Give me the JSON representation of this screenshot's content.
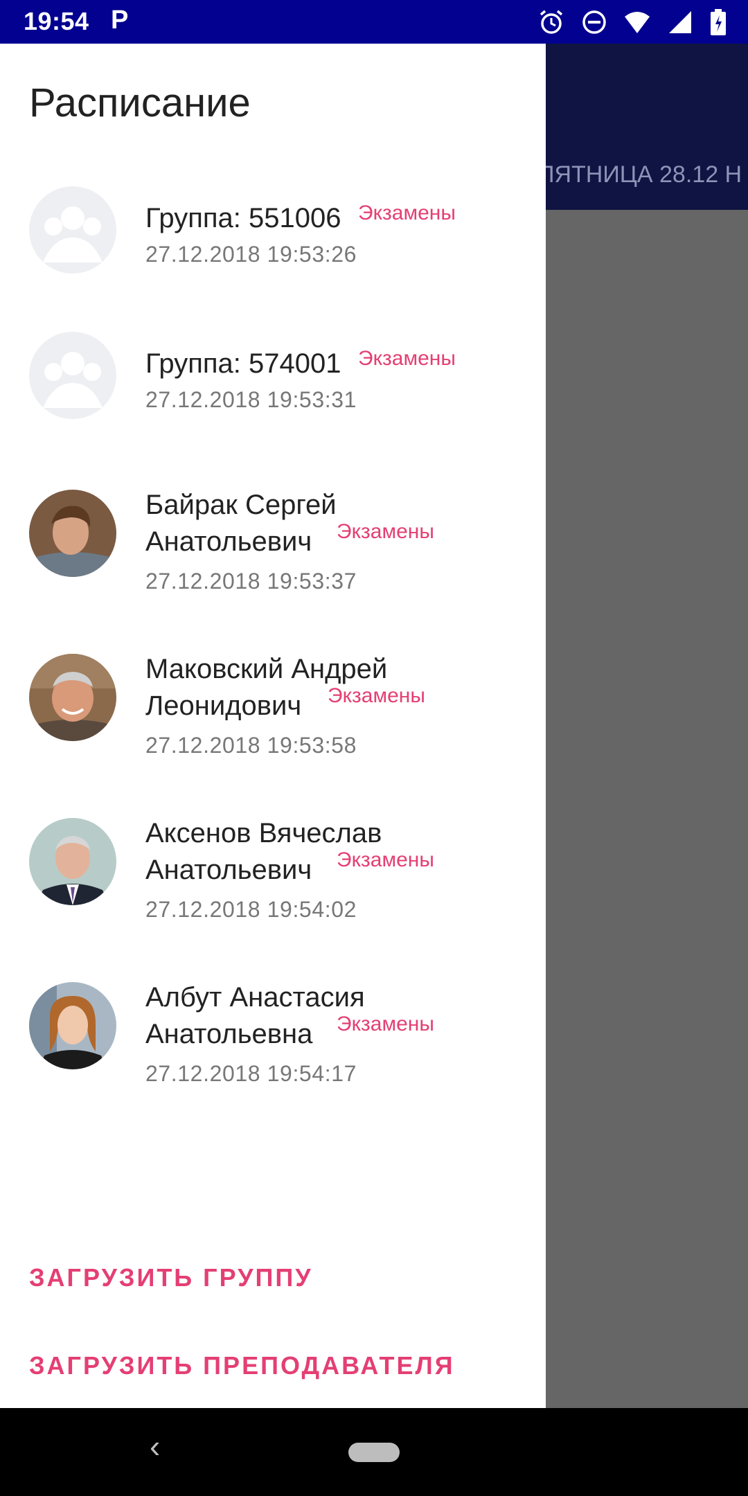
{
  "status_bar": {
    "time": "19:54",
    "app_indicator": "P",
    "icons": [
      "alarm-icon",
      "dnd-icon",
      "wifi-icon",
      "signal-icon",
      "battery-icon"
    ]
  },
  "background": {
    "day_label": "ПЯТНИЦА 28.12 Н"
  },
  "drawer": {
    "title": "Расписание",
    "entries": [
      {
        "name_line1": "Группа: 551006",
        "name_line2": "",
        "tag": "Экзамены",
        "date": "27.12.2018 19:53:26",
        "avatar": "group-placeholder-icon"
      },
      {
        "name_line1": "Группа: 574001",
        "name_line2": "",
        "tag": "Экзамены",
        "date": "27.12.2018 19:53:31",
        "avatar": "group-placeholder-icon"
      },
      {
        "name_line1": "Байрак Сергей",
        "name_line2": "Анатольевич",
        "tag": "Экзамены",
        "date": "27.12.2018 19:53:37",
        "avatar": "teacher-photo"
      },
      {
        "name_line1": "Маковский Андрей",
        "name_line2": "Леонидович",
        "tag": "Экзамены",
        "date": "27.12.2018 19:53:58",
        "avatar": "teacher-photo"
      },
      {
        "name_line1": "Аксенов Вячеслав",
        "name_line2": "Анатольевич",
        "tag": "Экзамены",
        "date": "27.12.2018 19:54:02",
        "avatar": "teacher-photo"
      },
      {
        "name_line1": "Албут Анастасия",
        "name_line2": "Анатольевна",
        "tag": "Экзамены",
        "date": "27.12.2018 19:54:17",
        "avatar": "teacher-photo"
      }
    ],
    "actions": {
      "load_group": "ЗАГРУЗИТЬ ГРУППУ",
      "load_teacher": "ЗАГРУЗИТЬ ПРЕПОДАВАТЕЛЯ"
    }
  },
  "colors": {
    "status_bar": "#03018f",
    "accent": "#e43f74",
    "toolbar": "#0f1442",
    "scrim": "#666666"
  }
}
